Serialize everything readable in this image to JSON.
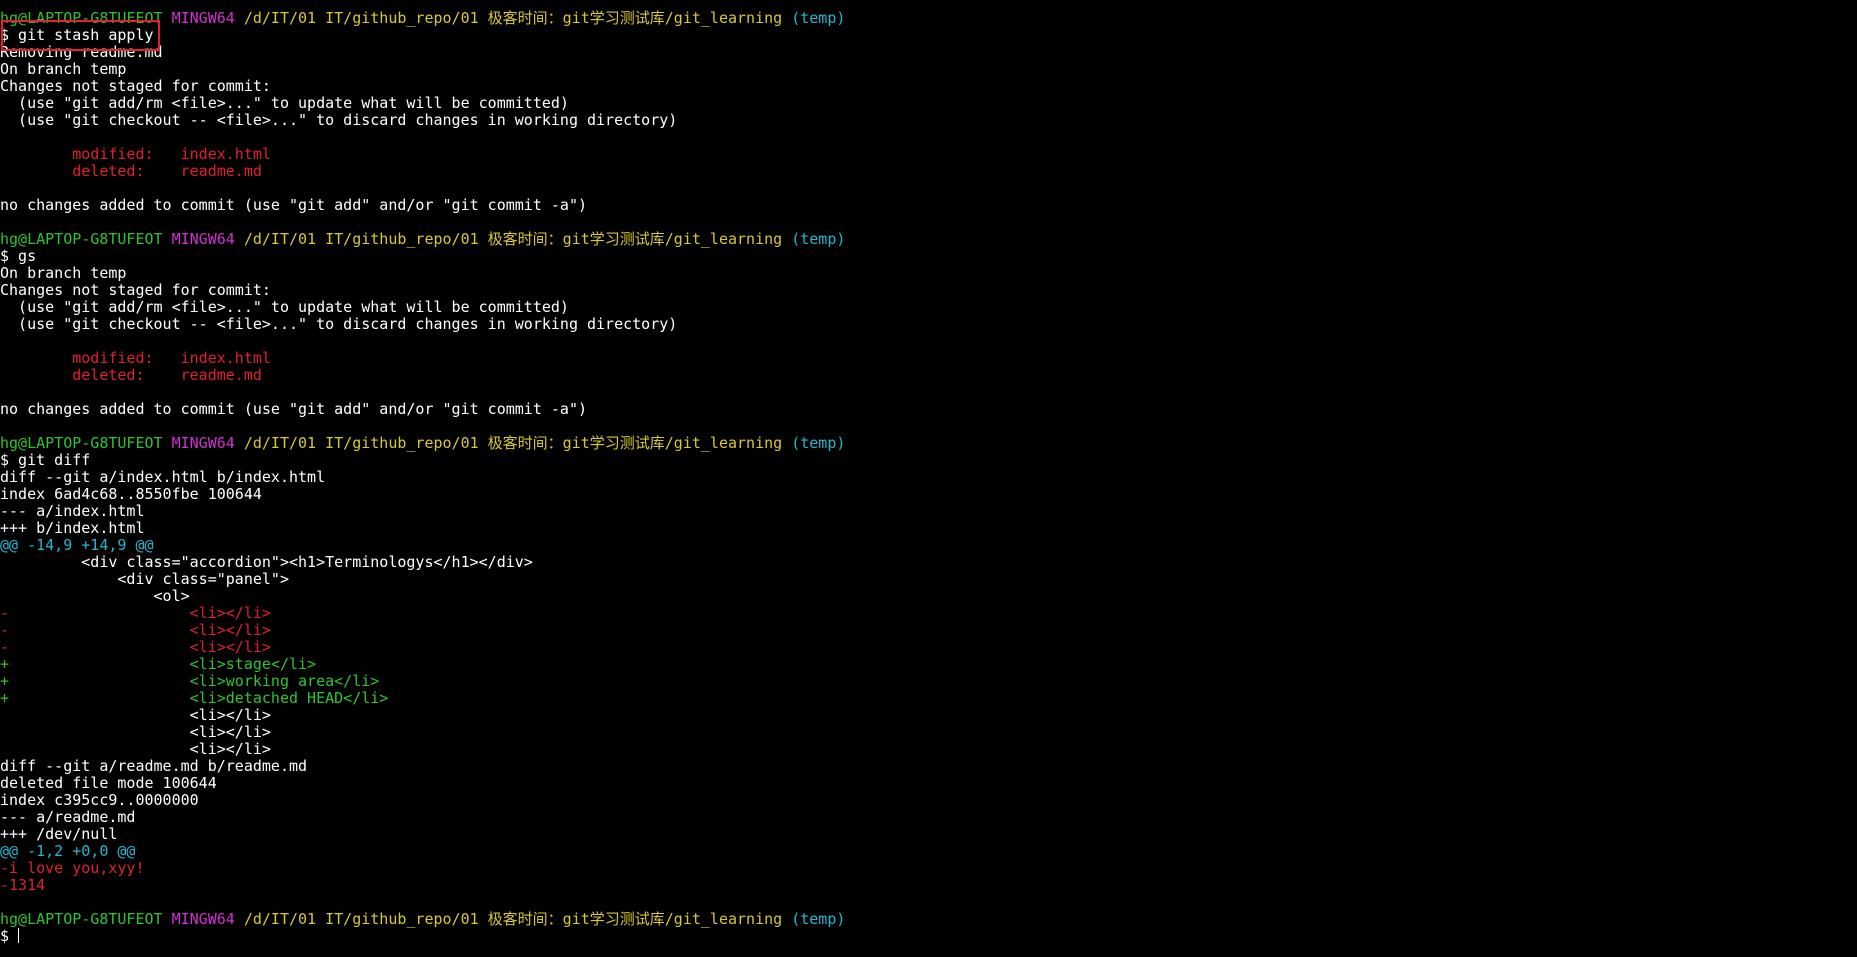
{
  "colors": {
    "background": "#000000",
    "user_host": "#2fc42f",
    "shell": "#d22fd2",
    "path": "#d8c832",
    "branch": "#24b7cf",
    "removed": "#e0202b",
    "added": "#2fc42f",
    "text": "#ffffff",
    "highlight_box": "#e8202a"
  },
  "lines": [
    [
      {
        "t": "hg@LAPTOP-G8TUFEOT",
        "c": "green"
      },
      {
        "t": " "
      },
      {
        "t": "MINGW64",
        "c": "magenta"
      },
      {
        "t": " "
      },
      {
        "t": "/d/IT/01 IT/github_repo/01 极客时间：git学习测试库/git_learning",
        "c": "yellow"
      },
      {
        "t": " "
      },
      {
        "t": "(temp)",
        "c": "cyan"
      }
    ],
    [
      {
        "t": "$ git stash apply",
        "c": "white"
      }
    ],
    [
      {
        "t": "Removing readme.md"
      }
    ],
    [
      {
        "t": "On branch temp"
      }
    ],
    [
      {
        "t": "Changes not staged for commit:"
      }
    ],
    [
      {
        "t": "  (use \"git add/rm <file>...\" to update what will be committed)"
      }
    ],
    [
      {
        "t": "  (use \"git checkout -- <file>...\" to discard changes in working directory)"
      }
    ],
    [],
    [
      {
        "t": "        modified:   index.html",
        "c": "red"
      }
    ],
    [
      {
        "t": "        deleted:    readme.md",
        "c": "red"
      }
    ],
    [],
    [
      {
        "t": "no changes added to commit (use \"git add\" and/or \"git commit -a\")"
      }
    ],
    [],
    [
      {
        "t": "hg@LAPTOP-G8TUFEOT",
        "c": "green"
      },
      {
        "t": " "
      },
      {
        "t": "MINGW64",
        "c": "magenta"
      },
      {
        "t": " "
      },
      {
        "t": "/d/IT/01 IT/github_repo/01 极客时间：git学习测试库/git_learning",
        "c": "yellow"
      },
      {
        "t": " "
      },
      {
        "t": "(temp)",
        "c": "cyan"
      }
    ],
    [
      {
        "t": "$ gs",
        "c": "white"
      }
    ],
    [
      {
        "t": "On branch temp"
      }
    ],
    [
      {
        "t": "Changes not staged for commit:"
      }
    ],
    [
      {
        "t": "  (use \"git add/rm <file>...\" to update what will be committed)"
      }
    ],
    [
      {
        "t": "  (use \"git checkout -- <file>...\" to discard changes in working directory)"
      }
    ],
    [],
    [
      {
        "t": "        modified:   index.html",
        "c": "red"
      }
    ],
    [
      {
        "t": "        deleted:    readme.md",
        "c": "red"
      }
    ],
    [],
    [
      {
        "t": "no changes added to commit (use \"git add\" and/or \"git commit -a\")"
      }
    ],
    [],
    [
      {
        "t": "hg@LAPTOP-G8TUFEOT",
        "c": "green"
      },
      {
        "t": " "
      },
      {
        "t": "MINGW64",
        "c": "magenta"
      },
      {
        "t": " "
      },
      {
        "t": "/d/IT/01 IT/github_repo/01 极客时间：git学习测试库/git_learning",
        "c": "yellow"
      },
      {
        "t": " "
      },
      {
        "t": "(temp)",
        "c": "cyan"
      }
    ],
    [
      {
        "t": "$ git diff",
        "c": "white"
      }
    ],
    [
      {
        "t": "diff --git a/index.html b/index.html",
        "c": "white"
      }
    ],
    [
      {
        "t": "index 6ad4c68..8550fbe 100644",
        "c": "white"
      }
    ],
    [
      {
        "t": "--- a/index.html",
        "c": "white"
      }
    ],
    [
      {
        "t": "+++ b/index.html",
        "c": "white"
      }
    ],
    [
      {
        "t": "@@ -14,9 +14,9 @@",
        "c": "cyan"
      }
    ],
    [
      {
        "t": "         <div class=\"accordion\"><h1>Terminologys</h1></div>"
      }
    ],
    [
      {
        "t": "             <div class=\"panel\">"
      }
    ],
    [
      {
        "t": "                 <ol>"
      }
    ],
    [
      {
        "t": "-                    <li></li>",
        "c": "red"
      }
    ],
    [
      {
        "t": "-                    <li></li>",
        "c": "red"
      }
    ],
    [
      {
        "t": "-                    <li></li>",
        "c": "red"
      }
    ],
    [
      {
        "t": "+                    <li>stage</li>",
        "c": "green"
      }
    ],
    [
      {
        "t": "+                    <li>working area</li>",
        "c": "green"
      }
    ],
    [
      {
        "t": "+                    <li>detached HEAD</li>",
        "c": "green"
      }
    ],
    [
      {
        "t": "                     <li></li>"
      }
    ],
    [
      {
        "t": "                     <li></li>"
      }
    ],
    [
      {
        "t": "                     <li></li>"
      }
    ],
    [
      {
        "t": "diff --git a/readme.md b/readme.md",
        "c": "white"
      }
    ],
    [
      {
        "t": "deleted file mode 100644",
        "c": "white"
      }
    ],
    [
      {
        "t": "index c395cc9..0000000",
        "c": "white"
      }
    ],
    [
      {
        "t": "--- a/readme.md",
        "c": "white"
      }
    ],
    [
      {
        "t": "+++ /dev/null",
        "c": "white"
      }
    ],
    [
      {
        "t": "@@ -1,2 +0,0 @@",
        "c": "cyan"
      }
    ],
    [
      {
        "t": "-i love you,xyy!",
        "c": "red"
      }
    ],
    [
      {
        "t": "-1314",
        "c": "red"
      }
    ],
    [],
    [
      {
        "t": "hg@LAPTOP-G8TUFEOT",
        "c": "green"
      },
      {
        "t": " "
      },
      {
        "t": "MINGW64",
        "c": "magenta"
      },
      {
        "t": " "
      },
      {
        "t": "/d/IT/01 IT/github_repo/01 极客时间：git学习测试库/git_learning",
        "c": "yellow"
      },
      {
        "t": " "
      },
      {
        "t": "(temp)",
        "c": "cyan"
      }
    ],
    [
      {
        "t": "$ ",
        "c": "white"
      },
      {
        "cursor": true
      }
    ]
  ]
}
